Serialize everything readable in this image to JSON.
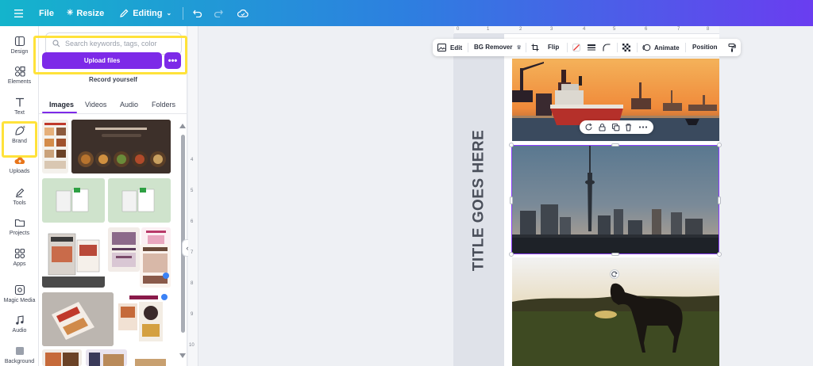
{
  "topbar": {
    "file_label": "File",
    "resize_label": "Resize",
    "editing_label": "Editing"
  },
  "rail": {
    "items": [
      {
        "label": "Design",
        "icon": "layout-icon"
      },
      {
        "label": "Elements",
        "icon": "shapes-icon"
      },
      {
        "label": "Text",
        "icon": "text-icon"
      },
      {
        "label": "Brand",
        "icon": "brand-icon"
      },
      {
        "label": "Uploads",
        "icon": "cloud-upload-icon"
      },
      {
        "label": "Tools",
        "icon": "pen-icon"
      },
      {
        "label": "Projects",
        "icon": "folder-icon"
      },
      {
        "label": "Apps",
        "icon": "apps-icon"
      },
      {
        "label": "Magic Media",
        "icon": "magic-media-icon"
      },
      {
        "label": "Audio",
        "icon": "music-icon"
      },
      {
        "label": "Background",
        "icon": "background-icon"
      }
    ]
  },
  "panel": {
    "search_placeholder": "Search keywords, tags, color",
    "upload_button": "Upload files",
    "more_button": "•••",
    "record_label": "Record yourself",
    "tabs": [
      "Images",
      "Videos",
      "Audio",
      "Folders"
    ],
    "active_tab": "Images"
  },
  "canvas": {
    "ruler_v": [
      "4",
      "5",
      "6",
      "7",
      "8",
      "9",
      "10"
    ],
    "ruler_h": [
      "0",
      "1",
      "2",
      "3",
      "4",
      "5",
      "6",
      "7",
      "8"
    ],
    "page_title": "TITLE GOES HERE"
  },
  "toolbar": {
    "edit_label": "Edit",
    "bg_remover_label": "BG Remover",
    "flip_label": "Flip",
    "animate_label": "Animate",
    "position_label": "Position"
  },
  "colors": {
    "accent": "#7d2ae8",
    "highlight": "#ffe23a"
  }
}
